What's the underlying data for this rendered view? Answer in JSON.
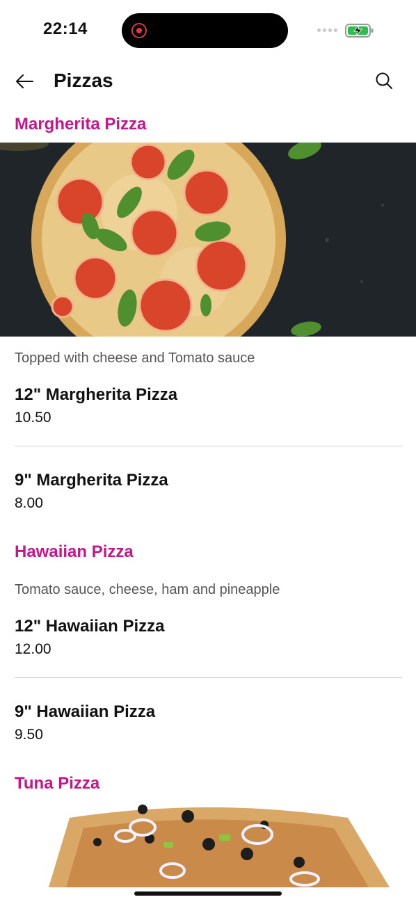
{
  "status_bar": {
    "time": "22:14"
  },
  "header": {
    "title": "Pizzas"
  },
  "categories": [
    {
      "title": "Margherita Pizza",
      "description": "Topped with cheese and Tomato sauce",
      "items": [
        {
          "name": "12\" Margherita Pizza",
          "price": "10.50"
        },
        {
          "name": "9\" Margherita Pizza",
          "price": "8.00"
        }
      ]
    },
    {
      "title": "Hawaiian Pizza",
      "description": "Tomato sauce, cheese, ham and pineapple",
      "items": [
        {
          "name": "12\" Hawaiian Pizza",
          "price": "12.00"
        },
        {
          "name": "9\" Hawaiian Pizza",
          "price": "9.50"
        }
      ]
    },
    {
      "title": "Tuna Pizza"
    }
  ],
  "colors": {
    "accent": "#c4168a",
    "battery_green": "#2dbf4e"
  },
  "icons": [
    "back-arrow-icon",
    "search-icon",
    "screen-record-icon",
    "battery-charging-icon"
  ]
}
